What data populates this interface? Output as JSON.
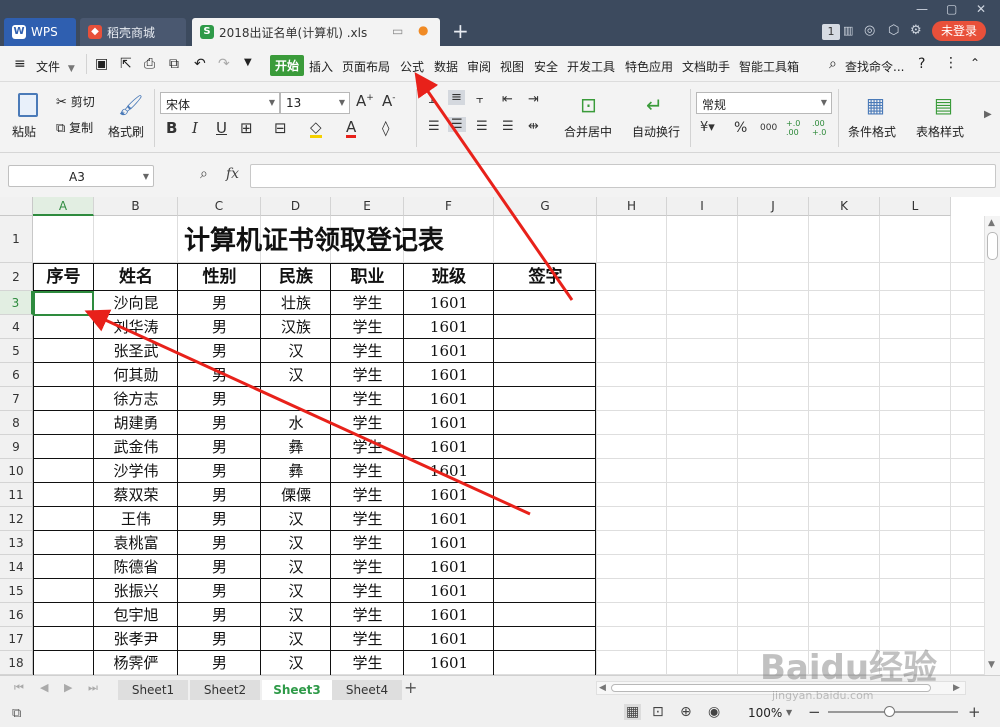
{
  "titlebar": {
    "tabs": [
      {
        "label": "WPS",
        "icon": "wps-logo-icon"
      },
      {
        "label": "稻壳商城",
        "icon": "docer-icon"
      },
      {
        "label": "2018出证名单(计算机) .xls",
        "icon": "spreadsheet-icon"
      }
    ],
    "badge": "1",
    "login_label": "未登录"
  },
  "menubar": {
    "file_label": "文件",
    "items": [
      "开始",
      "插入",
      "页面布局",
      "公式",
      "数据",
      "审阅",
      "视图",
      "安全",
      "开发工具",
      "特色应用",
      "文档助手",
      "智能工具箱"
    ],
    "search_label": "查找命令..."
  },
  "ribbon": {
    "paste": "粘贴",
    "cut": "剪切",
    "copy": "复制",
    "format_painter": "格式刷",
    "font_name": "宋体",
    "font_size": "13",
    "merge_center": "合并居中",
    "wrap_text": "自动换行",
    "number_format": "常规",
    "conditional_format": "条件格式",
    "table_style": "表格样式",
    "percent": "%",
    "thousands": "000",
    "inc_decimal": "+.0 .00",
    "dec_decimal": ".00 +.0"
  },
  "formula_bar": {
    "name_box": "A3",
    "fx": "fx",
    "value": ""
  },
  "sheet": {
    "columns": [
      "A",
      "B",
      "C",
      "D",
      "E",
      "F",
      "G",
      "H",
      "I",
      "J",
      "K",
      "L"
    ],
    "rows": [
      "1",
      "2",
      "3",
      "4",
      "5",
      "6",
      "7",
      "8",
      "9",
      "10",
      "11",
      "12",
      "13",
      "14",
      "15",
      "16",
      "17",
      "18"
    ],
    "title": "计算机证书领取登记表",
    "headers": [
      "序号",
      "姓名",
      "性别",
      "民族",
      "职业",
      "班级",
      "签字"
    ],
    "data": [
      [
        "",
        "沙向昆",
        "男",
        "壮族",
        "学生",
        "1601",
        ""
      ],
      [
        "",
        "刘华涛",
        "男",
        "汉族",
        "学生",
        "1601",
        ""
      ],
      [
        "",
        "张圣武",
        "男",
        "汉",
        "学生",
        "1601",
        ""
      ],
      [
        "",
        "何其勋",
        "男",
        "汉",
        "学生",
        "1601",
        ""
      ],
      [
        "",
        "徐方志",
        "男",
        "",
        "学生",
        "1601",
        ""
      ],
      [
        "",
        "胡建勇",
        "男",
        "水",
        "学生",
        "1601",
        ""
      ],
      [
        "",
        "武金伟",
        "男",
        "彝",
        "学生",
        "1601",
        ""
      ],
      [
        "",
        "沙学伟",
        "男",
        "彝",
        "学生",
        "1601",
        ""
      ],
      [
        "",
        "蔡双荣",
        "男",
        "傈僳",
        "学生",
        "1601",
        ""
      ],
      [
        "",
        "王伟",
        "男",
        "汉",
        "学生",
        "1601",
        ""
      ],
      [
        "",
        "袁桃富",
        "男",
        "汉",
        "学生",
        "1601",
        ""
      ],
      [
        "",
        "陈德省",
        "男",
        "汉",
        "学生",
        "1601",
        ""
      ],
      [
        "",
        "张振兴",
        "男",
        "汉",
        "学生",
        "1601",
        ""
      ],
      [
        "",
        "包宇旭",
        "男",
        "汉",
        "学生",
        "1601",
        ""
      ],
      [
        "",
        "张孝尹",
        "男",
        "汉",
        "学生",
        "1601",
        ""
      ],
      [
        "",
        "杨霁俨",
        "男",
        "汉",
        "学生",
        "1601",
        ""
      ]
    ]
  },
  "sheet_tabs": [
    "Sheet1",
    "Sheet2",
    "Sheet3",
    "Sheet4"
  ],
  "active_sheet": "Sheet3",
  "status": {
    "zoom": "100%"
  },
  "watermark": {
    "main": "Baidu经验",
    "sub": "jingyan.baidu.com"
  },
  "colors": {
    "titlebar_bg": "#3c4a5e",
    "accent_green": "#3a9b3a",
    "login_red": "#e8503a",
    "arrow_red": "#e8211a"
  }
}
